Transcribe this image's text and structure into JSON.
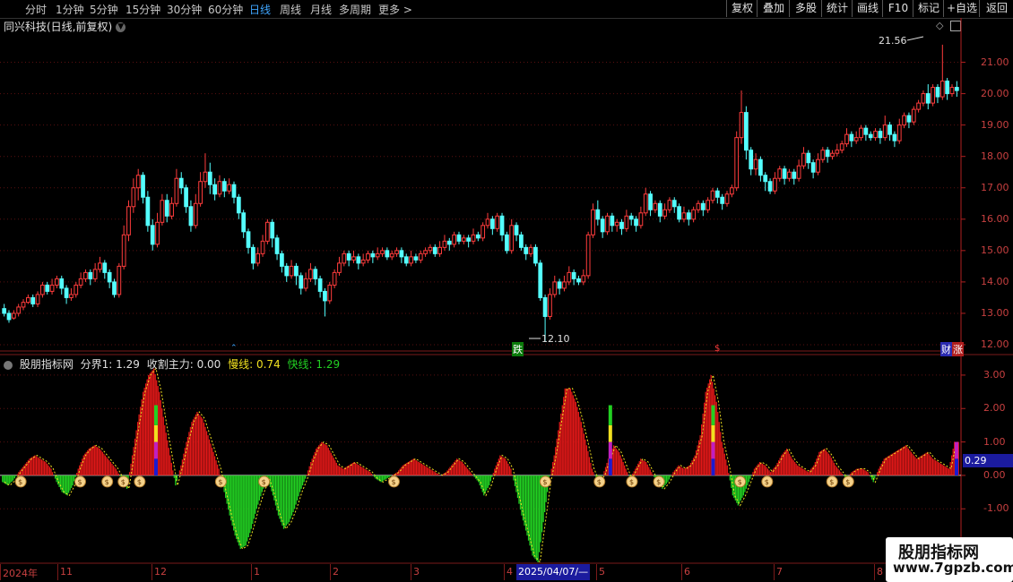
{
  "toolbar": {
    "timeframes": [
      "分时",
      "1分钟",
      "5分钟",
      "15分钟",
      "30分钟",
      "60分钟",
      "日线",
      "周线",
      "月线",
      "多周期",
      "更多 >"
    ],
    "active_timeframe": "日线",
    "right_buttons": [
      "复权",
      "叠加",
      "多股",
      "统计",
      "画线",
      "F10",
      "标记",
      "+自选",
      "返回"
    ]
  },
  "chart_title": "同兴科技(日线,前复权)",
  "price_axis": [
    "21.00",
    "20.00",
    "19.00",
    "18.00",
    "17.00",
    "16.00",
    "15.00",
    "14.00",
    "13.00",
    "12.00"
  ],
  "high_marker": "21.56",
  "low_marker": "12.10",
  "event_badges": {
    "down": "跌",
    "cai": "财",
    "zhang": "涨"
  },
  "indicator_legend": {
    "name": "股朋指标网",
    "boundary": "分界1: 1.29",
    "harvest": "收割主力: 0.00",
    "slow": "慢线: 0.74",
    "fast": "快线: 1.29"
  },
  "indicator_axis": [
    "3.00",
    "2.00",
    "1.00",
    "0.00",
    "-1.00"
  ],
  "indicator_value_tag": "0.29",
  "date_axis": [
    "2024年",
    "11",
    "12",
    "1",
    "2",
    "3",
    "4",
    "5",
    "6",
    "7",
    "8"
  ],
  "cursor_date": "2025/04/07/—",
  "watermark": {
    "title": "股朋指标网",
    "url": "www.7gpzb.com"
  },
  "colors": {
    "up": "#ff3c3c",
    "down": "#54ffff",
    "pos_bar": "#e01818",
    "neg_bar": "#22d022",
    "axis": "#c84040",
    "active": "#3fa6ff"
  },
  "chart_data": {
    "type": "candlestick",
    "price_ylim": [
      11.8,
      21.9
    ],
    "indicator_ylim": [
      -2.6,
      3.4
    ],
    "candles": [
      [
        13.15,
        13.0,
        13.3,
        12.9
      ],
      [
        13.0,
        12.8,
        13.1,
        12.7
      ],
      [
        12.85,
        13.0,
        13.1,
        12.8
      ],
      [
        13.0,
        13.2,
        13.3,
        12.9
      ],
      [
        13.2,
        13.35,
        13.45,
        13.1
      ],
      [
        13.35,
        13.5,
        13.6,
        13.3
      ],
      [
        13.5,
        13.3,
        13.6,
        13.2
      ],
      [
        13.3,
        13.6,
        13.7,
        13.2
      ],
      [
        13.6,
        13.9,
        14.0,
        13.5
      ],
      [
        13.9,
        13.7,
        14.0,
        13.6
      ],
      [
        13.7,
        13.9,
        14.1,
        13.6
      ],
      [
        13.9,
        14.1,
        14.2,
        13.8
      ],
      [
        14.1,
        13.8,
        14.2,
        13.6
      ],
      [
        13.8,
        13.5,
        13.9,
        13.3
      ],
      [
        13.5,
        13.6,
        13.8,
        13.4
      ],
      [
        13.6,
        13.9,
        14.0,
        13.5
      ],
      [
        13.9,
        14.1,
        14.3,
        13.8
      ],
      [
        14.1,
        14.3,
        14.4,
        14.0
      ],
      [
        14.3,
        14.1,
        14.4,
        13.9
      ],
      [
        14.1,
        14.4,
        14.6,
        14.0
      ],
      [
        14.4,
        14.6,
        14.8,
        14.3
      ],
      [
        14.6,
        14.3,
        14.7,
        14.1
      ],
      [
        14.3,
        14.0,
        14.4,
        13.8
      ],
      [
        14.0,
        13.6,
        14.1,
        13.5
      ],
      [
        13.6,
        14.5,
        14.6,
        13.5
      ],
      [
        14.5,
        15.5,
        15.8,
        14.4
      ],
      [
        15.5,
        16.4,
        16.6,
        15.3
      ],
      [
        16.4,
        17.0,
        17.3,
        16.2
      ],
      [
        17.0,
        17.4,
        17.6,
        16.6
      ],
      [
        17.4,
        16.7,
        17.5,
        16.5
      ],
      [
        16.7,
        15.8,
        16.9,
        15.6
      ],
      [
        15.8,
        15.2,
        16.0,
        15.0
      ],
      [
        15.2,
        15.9,
        16.2,
        15.1
      ],
      [
        15.9,
        16.6,
        16.8,
        15.8
      ],
      [
        16.6,
        16.1,
        16.8,
        15.9
      ],
      [
        16.1,
        16.5,
        16.7,
        16.0
      ],
      [
        16.5,
        17.3,
        17.6,
        16.4
      ],
      [
        17.3,
        17.0,
        17.5,
        16.8
      ],
      [
        17.0,
        16.4,
        17.1,
        16.2
      ],
      [
        16.4,
        15.8,
        16.6,
        15.6
      ],
      [
        15.8,
        16.5,
        16.8,
        15.7
      ],
      [
        16.5,
        17.2,
        17.5,
        16.4
      ],
      [
        17.2,
        17.5,
        18.1,
        17.0
      ],
      [
        17.5,
        17.1,
        17.8,
        16.8
      ],
      [
        17.1,
        16.8,
        17.3,
        16.6
      ],
      [
        16.8,
        17.2,
        17.4,
        16.7
      ],
      [
        17.2,
        16.9,
        17.3,
        16.7
      ],
      [
        16.9,
        17.1,
        17.3,
        16.8
      ],
      [
        17.1,
        16.7,
        17.2,
        16.5
      ],
      [
        16.7,
        16.2,
        16.8,
        16.0
      ],
      [
        16.2,
        15.6,
        16.3,
        15.4
      ],
      [
        15.6,
        15.1,
        15.7,
        14.9
      ],
      [
        15.1,
        14.6,
        15.2,
        14.4
      ],
      [
        14.6,
        14.9,
        15.1,
        14.5
      ],
      [
        14.9,
        15.3,
        15.5,
        14.8
      ],
      [
        15.3,
        15.9,
        16.0,
        15.2
      ],
      [
        15.9,
        15.4,
        16.0,
        15.1
      ],
      [
        15.4,
        14.9,
        15.5,
        14.7
      ],
      [
        14.9,
        14.5,
        15.0,
        14.3
      ],
      [
        14.5,
        14.2,
        14.6,
        14.0
      ],
      [
        14.2,
        14.5,
        14.7,
        14.1
      ],
      [
        14.5,
        14.2,
        14.6,
        13.9
      ],
      [
        14.2,
        13.8,
        14.3,
        13.6
      ],
      [
        13.8,
        14.1,
        14.3,
        13.7
      ],
      [
        14.1,
        14.4,
        14.6,
        14.0
      ],
      [
        14.4,
        14.1,
        14.5,
        13.9
      ],
      [
        14.1,
        13.7,
        14.2,
        13.5
      ],
      [
        13.7,
        13.4,
        13.8,
        12.9
      ],
      [
        13.4,
        13.9,
        14.0,
        13.3
      ],
      [
        13.9,
        14.3,
        14.4,
        13.8
      ],
      [
        14.3,
        14.6,
        14.8,
        14.2
      ],
      [
        14.6,
        14.9,
        15.0,
        14.5
      ],
      [
        14.9,
        14.7,
        15.0,
        14.5
      ],
      [
        14.7,
        14.8,
        15.0,
        14.6
      ],
      [
        14.8,
        14.6,
        14.9,
        14.4
      ],
      [
        14.6,
        14.7,
        14.9,
        14.5
      ],
      [
        14.7,
        14.9,
        15.0,
        14.6
      ],
      [
        14.9,
        14.8,
        15.0,
        14.6
      ],
      [
        14.8,
        14.9,
        15.1,
        14.7
      ],
      [
        14.9,
        15.0,
        15.1,
        14.8
      ],
      [
        15.0,
        14.8,
        15.1,
        14.7
      ],
      [
        14.8,
        14.9,
        15.0,
        14.7
      ],
      [
        14.9,
        15.0,
        15.1,
        14.8
      ],
      [
        15.0,
        14.8,
        15.1,
        14.6
      ],
      [
        14.8,
        14.6,
        14.9,
        14.5
      ],
      [
        14.6,
        14.8,
        15.0,
        14.5
      ],
      [
        14.8,
        14.7,
        14.9,
        14.6
      ],
      [
        14.7,
        14.9,
        15.0,
        14.6
      ],
      [
        14.9,
        15.0,
        15.1,
        14.8
      ],
      [
        15.0,
        15.1,
        15.2,
        14.9
      ],
      [
        15.1,
        14.9,
        15.2,
        14.8
      ],
      [
        14.9,
        15.1,
        15.3,
        14.8
      ],
      [
        15.1,
        15.3,
        15.5,
        15.0
      ],
      [
        15.3,
        15.2,
        15.4,
        15.0
      ],
      [
        15.2,
        15.5,
        15.6,
        15.1
      ],
      [
        15.5,
        15.3,
        15.6,
        15.2
      ],
      [
        15.3,
        15.4,
        15.5,
        15.2
      ],
      [
        15.4,
        15.3,
        15.5,
        15.1
      ],
      [
        15.3,
        15.5,
        15.7,
        15.2
      ],
      [
        15.5,
        15.4,
        15.6,
        15.3
      ],
      [
        15.4,
        15.8,
        15.9,
        15.3
      ],
      [
        15.8,
        16.0,
        16.2,
        15.7
      ],
      [
        16.0,
        15.7,
        16.1,
        15.5
      ],
      [
        15.7,
        16.1,
        16.2,
        15.6
      ],
      [
        16.1,
        15.5,
        16.2,
        15.3
      ],
      [
        15.5,
        15.0,
        15.6,
        14.9
      ],
      [
        15.0,
        15.8,
        16.0,
        14.9
      ],
      [
        15.8,
        15.5,
        15.9,
        15.3
      ],
      [
        15.5,
        15.1,
        15.6,
        15.0
      ],
      [
        15.1,
        14.9,
        15.2,
        14.7
      ],
      [
        14.9,
        15.1,
        15.2,
        14.8
      ],
      [
        15.1,
        14.6,
        15.2,
        14.5
      ],
      [
        14.6,
        13.5,
        14.7,
        13.4
      ],
      [
        13.5,
        12.9,
        13.6,
        12.1
      ],
      [
        12.9,
        13.6,
        13.8,
        12.8
      ],
      [
        13.6,
        14.0,
        14.2,
        13.5
      ],
      [
        14.0,
        13.8,
        14.1,
        13.6
      ],
      [
        13.8,
        14.0,
        14.2,
        13.7
      ],
      [
        14.0,
        14.3,
        14.5,
        13.9
      ],
      [
        14.3,
        14.1,
        14.4,
        13.9
      ],
      [
        14.1,
        14.0,
        14.2,
        13.9
      ],
      [
        14.0,
        14.2,
        14.4,
        13.9
      ],
      [
        14.2,
        15.5,
        15.6,
        14.1
      ],
      [
        15.5,
        16.3,
        16.5,
        15.4
      ],
      [
        16.3,
        16.0,
        16.6,
        15.8
      ],
      [
        16.0,
        15.6,
        16.1,
        15.4
      ],
      [
        15.6,
        16.1,
        16.2,
        15.5
      ],
      [
        16.1,
        15.8,
        16.2,
        15.6
      ],
      [
        15.8,
        15.9,
        16.0,
        15.6
      ],
      [
        15.9,
        15.7,
        16.0,
        15.5
      ],
      [
        15.7,
        16.1,
        16.3,
        15.6
      ],
      [
        16.1,
        16.0,
        16.2,
        15.8
      ],
      [
        16.0,
        15.8,
        16.1,
        15.6
      ],
      [
        15.8,
        16.2,
        16.4,
        15.7
      ],
      [
        16.2,
        16.8,
        17.0,
        16.1
      ],
      [
        16.8,
        16.3,
        16.9,
        16.1
      ],
      [
        16.3,
        16.5,
        16.6,
        16.2
      ],
      [
        16.5,
        16.1,
        16.6,
        15.9
      ],
      [
        16.1,
        16.3,
        16.5,
        16.0
      ],
      [
        16.3,
        16.6,
        16.7,
        16.2
      ],
      [
        16.6,
        16.4,
        16.7,
        16.2
      ],
      [
        16.4,
        16.0,
        16.5,
        15.9
      ],
      [
        16.0,
        16.2,
        16.4,
        15.9
      ],
      [
        16.2,
        16.0,
        16.3,
        15.8
      ],
      [
        16.0,
        16.3,
        16.4,
        15.9
      ],
      [
        16.3,
        16.5,
        16.6,
        16.2
      ],
      [
        16.5,
        16.3,
        16.6,
        16.1
      ],
      [
        16.3,
        16.6,
        16.7,
        16.2
      ],
      [
        16.6,
        16.9,
        17.0,
        16.5
      ],
      [
        16.9,
        16.7,
        17.0,
        16.5
      ],
      [
        16.7,
        16.5,
        16.8,
        16.3
      ],
      [
        16.5,
        16.8,
        16.9,
        16.4
      ],
      [
        16.8,
        17.0,
        17.1,
        16.7
      ],
      [
        17.0,
        18.6,
        18.8,
        16.9
      ],
      [
        18.6,
        19.4,
        20.1,
        18.4
      ],
      [
        19.4,
        18.2,
        19.6,
        17.9
      ],
      [
        18.2,
        17.6,
        18.3,
        17.4
      ],
      [
        17.6,
        17.9,
        18.1,
        17.4
      ],
      [
        17.9,
        17.4,
        18.0,
        17.2
      ],
      [
        17.4,
        17.2,
        17.5,
        16.9
      ],
      [
        17.2,
        16.9,
        17.3,
        16.8
      ],
      [
        16.9,
        17.3,
        17.5,
        16.8
      ],
      [
        17.3,
        17.6,
        17.7,
        17.2
      ],
      [
        17.6,
        17.3,
        17.7,
        17.1
      ],
      [
        17.3,
        17.5,
        17.6,
        17.2
      ],
      [
        17.5,
        17.3,
        17.6,
        17.1
      ],
      [
        17.3,
        17.7,
        17.9,
        17.2
      ],
      [
        17.7,
        18.1,
        18.3,
        17.6
      ],
      [
        18.1,
        17.8,
        18.2,
        17.6
      ],
      [
        17.8,
        17.5,
        17.9,
        17.3
      ],
      [
        17.5,
        17.9,
        18.1,
        17.4
      ],
      [
        17.9,
        18.2,
        18.3,
        17.8
      ],
      [
        18.2,
        18.0,
        18.3,
        17.8
      ],
      [
        18.0,
        18.1,
        18.2,
        17.9
      ],
      [
        18.1,
        18.2,
        18.4,
        18.0
      ],
      [
        18.2,
        18.4,
        18.5,
        18.1
      ],
      [
        18.4,
        18.7,
        18.9,
        18.3
      ],
      [
        18.7,
        18.5,
        18.8,
        18.3
      ],
      [
        18.5,
        18.6,
        18.8,
        18.4
      ],
      [
        18.6,
        18.9,
        19.0,
        18.5
      ],
      [
        18.9,
        18.7,
        19.0,
        18.5
      ],
      [
        18.7,
        18.6,
        18.8,
        18.5
      ],
      [
        18.6,
        18.8,
        18.9,
        18.5
      ],
      [
        18.8,
        18.6,
        18.9,
        18.4
      ],
      [
        18.6,
        19.0,
        19.3,
        18.5
      ],
      [
        19.0,
        18.7,
        19.1,
        18.5
      ],
      [
        18.7,
        18.5,
        18.8,
        18.3
      ],
      [
        18.5,
        19.0,
        19.2,
        18.4
      ],
      [
        19.0,
        19.3,
        19.4,
        18.9
      ],
      [
        19.3,
        19.1,
        19.4,
        18.9
      ],
      [
        19.1,
        19.5,
        19.6,
        19.0
      ],
      [
        19.5,
        19.7,
        19.8,
        19.4
      ],
      [
        19.7,
        20.0,
        20.1,
        19.6
      ],
      [
        20.0,
        19.7,
        20.3,
        19.5
      ],
      [
        19.7,
        20.2,
        20.3,
        19.6
      ],
      [
        20.2,
        19.9,
        20.3,
        19.7
      ],
      [
        19.9,
        20.4,
        21.56,
        19.8
      ],
      [
        20.4,
        20.0,
        20.5,
        19.8
      ],
      [
        20.0,
        20.2,
        20.3,
        19.9
      ],
      [
        20.2,
        20.1,
        20.4,
        19.9
      ]
    ],
    "indicator": [
      -0.2,
      -0.3,
      -0.15,
      0.1,
      0.3,
      0.5,
      0.6,
      0.5,
      0.4,
      0.2,
      -0.2,
      -0.5,
      -0.6,
      -0.3,
      0.2,
      0.6,
      0.8,
      0.9,
      0.8,
      0.6,
      0.4,
      0.2,
      -0.1,
      -0.4,
      0.6,
      1.6,
      2.5,
      3.0,
      3.2,
      2.5,
      1.5,
      0.6,
      -0.3,
      0.3,
      1.0,
      1.6,
      1.9,
      1.7,
      1.2,
      0.7,
      0.2,
      -0.5,
      -1.2,
      -1.8,
      -2.2,
      -2.1,
      -1.6,
      -1.0,
      -0.5,
      -0.1,
      -0.6,
      -1.2,
      -1.6,
      -1.4,
      -1.0,
      -0.5,
      -0.1,
      0.4,
      0.8,
      1.0,
      0.9,
      0.6,
      0.3,
      0.2,
      0.3,
      0.4,
      0.3,
      0.2,
      0.1,
      -0.1,
      -0.2,
      -0.1,
      0.0,
      0.1,
      0.3,
      0.4,
      0.5,
      0.4,
      0.3,
      0.2,
      0.1,
      0.0,
      0.1,
      0.3,
      0.5,
      0.4,
      0.2,
      0.0,
      -0.2,
      -0.6,
      -0.3,
      0.2,
      0.6,
      0.5,
      0.2,
      -0.5,
      -1.2,
      -1.8,
      -2.4,
      -2.6,
      -1.4,
      -0.2,
      0.6,
      1.6,
      2.6,
      2.6,
      2.2,
      1.6,
      0.9,
      0.2,
      -0.2,
      0.0,
      0.5,
      0.9,
      0.7,
      0.3,
      -0.1,
      0.2,
      0.5,
      0.4,
      0.1,
      -0.2,
      -0.4,
      -0.2,
      0.1,
      0.3,
      0.2,
      0.3,
      0.6,
      1.2,
      2.5,
      3.0,
      2.2,
      1.0,
      0.3,
      -0.6,
      -0.9,
      -0.6,
      -0.2,
      0.2,
      0.4,
      0.3,
      0.1,
      0.3,
      0.6,
      0.8,
      0.5,
      0.3,
      0.2,
      0.1,
      0.3,
      0.7,
      0.8,
      0.6,
      0.3,
      0.1,
      -0.1,
      0.1,
      0.2,
      0.2,
      0.1,
      -0.2,
      0.2,
      0.5,
      0.6,
      0.7,
      0.8,
      0.9,
      0.7,
      0.5,
      0.6,
      0.7,
      0.5,
      0.4,
      0.3,
      0.2,
      1.0
    ]
  }
}
